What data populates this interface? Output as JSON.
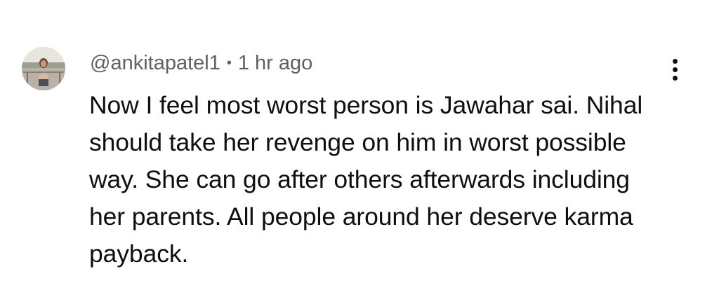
{
  "comment": {
    "author_handle": "@ankitapatel1",
    "separator": "•",
    "timestamp": "1 hr ago",
    "text": "Now I feel most worst person is Jawahar sai. Nihal should take her revenge on him in worst possible way. She can go after others afterwards including her parents. All people around her deserve karma payback.",
    "avatar_icon": "user-avatar-photo",
    "more_icon": "more-vert-icon"
  },
  "colors": {
    "background": "#ffffff",
    "meta_text": "#606060",
    "body_text": "#0f0f0f"
  }
}
